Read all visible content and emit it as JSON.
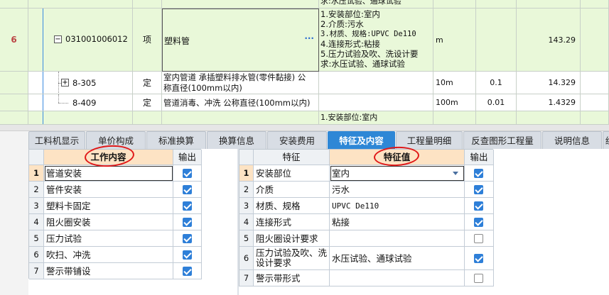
{
  "top_grid": {
    "row_cont_feature": "求:水压试验、通球试验",
    "row6": {
      "num": "6",
      "code": "031001006012",
      "type": "项",
      "name": "塑料管",
      "ellipsis": "···",
      "features": [
        "1.安装部位:室内",
        "2.介质:污水",
        "3.材质、规格:UPVC De110",
        "4.连接形式:粘接",
        "5.压力试验及吹、洗设计要",
        "求:水压试验、通球试验"
      ],
      "unit": "m",
      "quantity": "143.29"
    },
    "sub1": {
      "code": "8-305",
      "type": "定",
      "name_l1": "室内管道 承插塑料排水管(零件黏接) 公",
      "name_l2": "称直径(100mm以内)",
      "unit": "10m",
      "coef": "0.1",
      "quantity": "14.329"
    },
    "sub2": {
      "code": "8-409",
      "type": "定",
      "name": "管道消毒、冲洗 公称直径(100mm以内)",
      "unit": "100m",
      "coef": "0.01",
      "quantity": "1.4329"
    },
    "row_next_feature": "1.安装部位:室内"
  },
  "tabs": [
    {
      "label": "工料机显示",
      "active": false
    },
    {
      "label": "单价构成",
      "active": false
    },
    {
      "label": "标准换算",
      "active": false
    },
    {
      "label": "换算信息",
      "active": false
    },
    {
      "label": "安装费用",
      "active": false
    },
    {
      "label": "特征及内容",
      "active": true
    },
    {
      "label": "工程量明细",
      "active": false
    },
    {
      "label": "反查图形工程量",
      "active": false
    },
    {
      "label": "说明信息",
      "active": false
    },
    {
      "label": "组",
      "active": false
    }
  ],
  "work_table": {
    "header_content": "工作内容",
    "header_output": "输出",
    "rows": [
      {
        "num": "1",
        "content": "管道安装",
        "output": true
      },
      {
        "num": "2",
        "content": "管件安装",
        "output": true
      },
      {
        "num": "3",
        "content": "塑料卡固定",
        "output": true
      },
      {
        "num": "4",
        "content": "阻火圈安装",
        "output": true
      },
      {
        "num": "5",
        "content": "压力试验",
        "output": true
      },
      {
        "num": "6",
        "content": "吹扫、冲洗",
        "output": true
      },
      {
        "num": "7",
        "content": "警示带铺设",
        "output": true
      }
    ]
  },
  "feature_table": {
    "header_feature": "特征",
    "header_value": "特征值",
    "header_output": "输出",
    "rows": [
      {
        "num": "1",
        "feature": "安装部位",
        "value": "室内",
        "output": true
      },
      {
        "num": "2",
        "feature": "介质",
        "value": "污水",
        "output": true
      },
      {
        "num": "3",
        "feature": "材质、规格",
        "value": "UPVC De110",
        "output": true
      },
      {
        "num": "4",
        "feature": "连接形式",
        "value": "粘接",
        "output": true
      },
      {
        "num": "5",
        "feature": "阻火圈设计要求",
        "value": "",
        "output": false
      },
      {
        "num": "6",
        "feature_l1": "压力试验及吹、洗",
        "feature_l2": "设计要求",
        "value": "水压试验、通球试验",
        "output": true
      },
      {
        "num": "7",
        "feature": "警示带形式",
        "value": "",
        "output": false
      }
    ]
  },
  "colors": {
    "accent": "#2e87d6",
    "row_green": "#e9f8d9",
    "header_orange": "#fde3c4",
    "annotation_red": "#e01818"
  },
  "icons": [
    "collapse-minus-icon",
    "expand-plus-icon",
    "dropdown-arrow-icon",
    "checkbox-checked-icon",
    "checkbox-unchecked-icon"
  ]
}
